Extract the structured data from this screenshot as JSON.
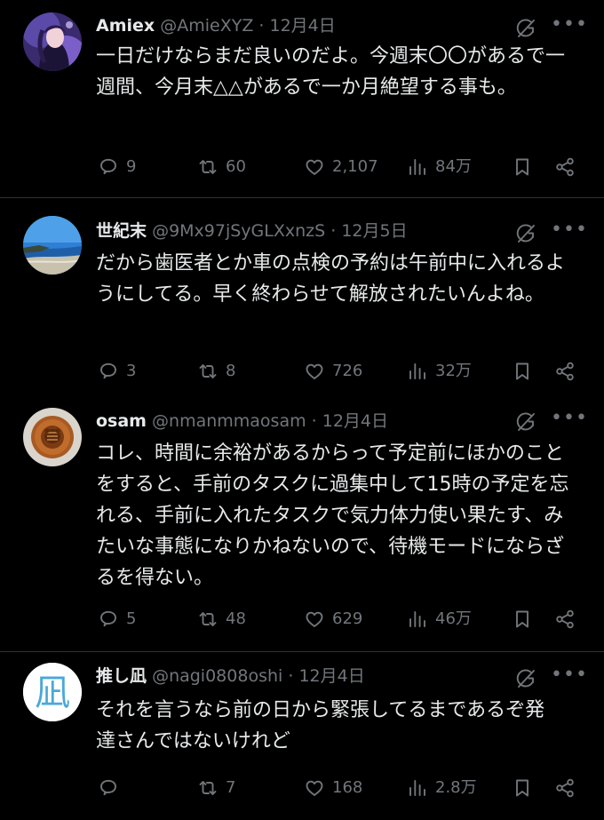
{
  "tweets": [
    {
      "name": "Amiex",
      "handle": "@AmieXYZ",
      "sep": "·",
      "date": "12月4日",
      "text": "一日だけならまだ良いのだよ。今週末〇〇があるで一週間、今月末△△があるで一か月絶望する事も。",
      "replies": "9",
      "reposts": "60",
      "likes": "2,107",
      "views": "84万"
    },
    {
      "name": "世紀末",
      "handle": "@9Mx97jSyGLXxnzS",
      "sep": "·",
      "date": "12月5日",
      "text": "だから歯医者とか車の点検の予約は午前中に入れるようにしてる。早く終わらせて解放されたいんよね。",
      "replies": "3",
      "reposts": "8",
      "likes": "726",
      "views": "32万"
    },
    {
      "name": "osam",
      "handle": "@nmanmmaosam",
      "sep": "·",
      "date": "12月4日",
      "text": "コレ、時間に余裕があるからって予定前にほかのことをすると、手前のタスクに過集中して15時の予定を忘れる、手前に入れたタスクで気力体力使い果たす、みたいな事態になりかねないので、待機モードにならざるを得ない。",
      "replies": "5",
      "reposts": "48",
      "likes": "629",
      "views": "46万"
    },
    {
      "name": "推し凪",
      "handle": "@nagi0808oshi",
      "sep": "·",
      "date": "12月4日",
      "text": "それを言うなら前の日から緊張してるまであるぞ発達さんではないけれど",
      "avatar_text": "凪",
      "replies": "",
      "reposts": "7",
      "likes": "168",
      "views": "2.8万"
    }
  ],
  "icons": {
    "reply": "reply-icon",
    "repost": "repost-icon",
    "like": "heart-icon",
    "views": "views-icon",
    "bookmark": "bookmark-icon",
    "share": "share-icon",
    "grok": "grok-icon",
    "more": "more-icon"
  },
  "more_glyph": "•••",
  "colors": {
    "background": "#000000",
    "text": "#e7e9ea",
    "secondary": "#71767b",
    "divider": "#2f3336"
  }
}
